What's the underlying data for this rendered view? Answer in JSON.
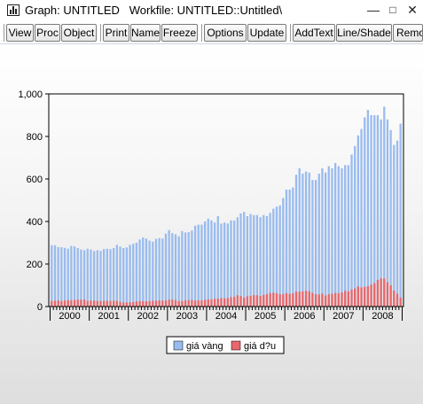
{
  "window": {
    "title": "Graph: UNTITLED   Workfile: UNTITLED::Untitled\\",
    "minimize_glyph": "—",
    "maximize_glyph": "□",
    "close_glyph": "✕",
    "icon": "bar-chart-icon"
  },
  "toolbar": {
    "buttons": [
      "View",
      "Proc",
      "Object",
      "Print",
      "Name",
      "Freeze",
      "Options",
      "Update",
      "AddText",
      "Line/Shade",
      "Remo"
    ]
  },
  "colors": {
    "series1": "#99bbee",
    "series2": "#e8676b",
    "axis": "#000000"
  },
  "chart_data": {
    "type": "bar",
    "title": "",
    "xlabel": "",
    "ylabel": "",
    "ylim": [
      0,
      1000
    ],
    "yticks": [
      "0",
      "200",
      "400",
      "600",
      "800",
      "1,000"
    ],
    "xticks": [
      "2000",
      "2001",
      "2002",
      "2003",
      "2004",
      "2005",
      "2006",
      "2007",
      "2008"
    ],
    "frequency": "monthly",
    "start": "2000-01",
    "grid": false,
    "legend_position": "bottom-center",
    "series": [
      {
        "name": "giá vàng",
        "color": "#99bbee",
        "values": [
          289,
          288,
          280,
          279,
          276,
          272,
          285,
          283,
          275,
          268,
          265,
          272,
          268,
          261,
          265,
          262,
          271,
          272,
          270,
          275,
          290,
          282,
          275,
          278,
          290,
          295,
          300,
          315,
          325,
          320,
          310,
          305,
          318,
          322,
          320,
          343,
          360,
          345,
          340,
          330,
          355,
          348,
          350,
          357,
          380,
          385,
          385,
          400,
          413,
          405,
          395,
          425,
          390,
          395,
          390,
          405,
          405,
          420,
          438,
          445,
          425,
          435,
          430,
          430,
          420,
          430,
          425,
          440,
          460,
          470,
          475,
          510,
          550,
          550,
          560,
          620,
          650,
          625,
          635,
          630,
          595,
          595,
          625,
          650,
          630,
          660,
          650,
          675,
          660,
          650,
          665,
          665,
          715,
          755,
          805,
          835,
          890,
          925,
          900,
          900,
          900,
          880,
          940,
          880,
          830,
          760,
          780,
          860
        ]
      },
      {
        "name": "giá d?u",
        "color": "#e8676b",
        "values": [
          26,
          28,
          29,
          26,
          28,
          31,
          30,
          31,
          33,
          32,
          33,
          26,
          28,
          28,
          26,
          26,
          27,
          27,
          26,
          27,
          27,
          22,
          19,
          19,
          20,
          21,
          24,
          26,
          25,
          25,
          26,
          27,
          28,
          29,
          27,
          29,
          32,
          33,
          30,
          25,
          26,
          29,
          30,
          31,
          28,
          29,
          29,
          31,
          34,
          34,
          36,
          37,
          40,
          38,
          40,
          44,
          46,
          53,
          49,
          42,
          48,
          50,
          54,
          53,
          50,
          55,
          58,
          64,
          65,
          62,
          58,
          58,
          63,
          60,
          62,
          70,
          70,
          71,
          74,
          72,
          64,
          58,
          57,
          61,
          52,
          58,
          60,
          63,
          63,
          66,
          74,
          71,
          80,
          85,
          95,
          90,
          92,
          96,
          103,
          110,
          125,
          133,
          132,
          114,
          100,
          75,
          60,
          42
        ]
      }
    ]
  }
}
